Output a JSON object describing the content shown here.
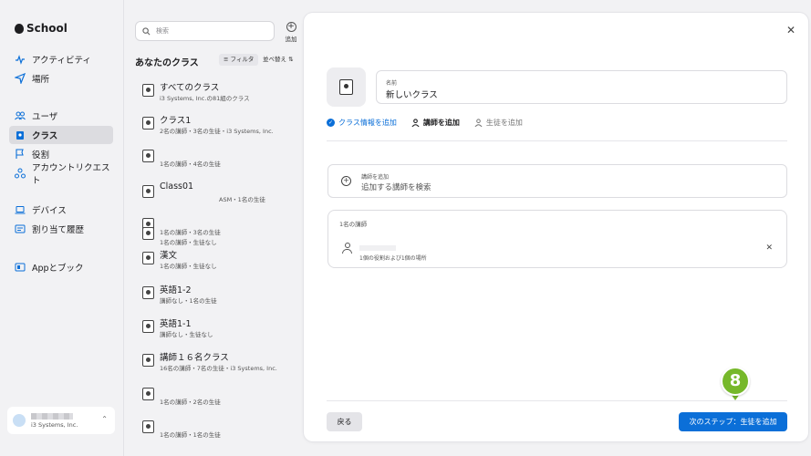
{
  "sidebar": {
    "brand": "School",
    "items": [
      {
        "label": "アクティビティ",
        "icon": "activity-icon"
      },
      {
        "label": "場所",
        "icon": "location-icon"
      },
      {
        "label": "ユーザ",
        "icon": "users-icon"
      },
      {
        "label": "クラス",
        "icon": "class-icon"
      },
      {
        "label": "役割",
        "icon": "flag-icon"
      },
      {
        "label": "アカウントリクエスト",
        "icon": "requests-icon"
      },
      {
        "label": "デバイス",
        "icon": "laptop-icon"
      },
      {
        "label": "割り当て履歴",
        "icon": "history-icon"
      },
      {
        "label": "Appとブック",
        "icon": "apps-books-icon"
      }
    ],
    "account": {
      "org": "i3 Systems, Inc."
    }
  },
  "list": {
    "search_placeholder": "検索",
    "add_label": "追加",
    "title": "あなたのクラス",
    "filter_label": "フィルタ",
    "sort_label": "並べ替え",
    "classes": [
      {
        "title": "すべてのクラス",
        "sub": "i3 Systems, Inc.の81組のクラス"
      },
      {
        "title": "クラス1",
        "sub": "2名の講師・3名の生徒・i3 Systems, Inc."
      },
      {
        "title": "",
        "sub": "1名の講師・4名の生徒"
      },
      {
        "title": "Class01",
        "sub": "ASM・1名の生徒"
      },
      {
        "title": "",
        "sub": "1名の講師・3名の生徒"
      },
      {
        "title": "",
        "sub": "1名の講師・生徒なし"
      },
      {
        "title": "漢文",
        "sub": "1名の講師・生徒なし"
      },
      {
        "title": "英語1-2",
        "sub": "講師なし・1名の生徒"
      },
      {
        "title": "英語1-1",
        "sub": "講師なし・生徒なし"
      },
      {
        "title": "講師１６名クラス",
        "sub": "16名の講師・7名の生徒・i3 Systems, Inc."
      },
      {
        "title": "",
        "sub": "1名の講師・2名の生徒"
      },
      {
        "title": "",
        "sub": "1名の講師・1名の生徒"
      }
    ]
  },
  "detail": {
    "name_label": "名前",
    "name_value": "新しいクラス",
    "steps": [
      "クラス情報を追加",
      "講師を追加",
      "生徒を追加"
    ],
    "teacher_search_label": "講師を追加",
    "teacher_search_placeholder": "追加する講師を検索",
    "teacher_count": "1名の講師",
    "teacher_roles": "1個の役割および1個の場所",
    "back_label": "戻る",
    "next_label": "次のステップ：生徒を追加",
    "callout_number": "8",
    "callout_color": "#76b82a",
    "accent": "#0b6fd8"
  }
}
